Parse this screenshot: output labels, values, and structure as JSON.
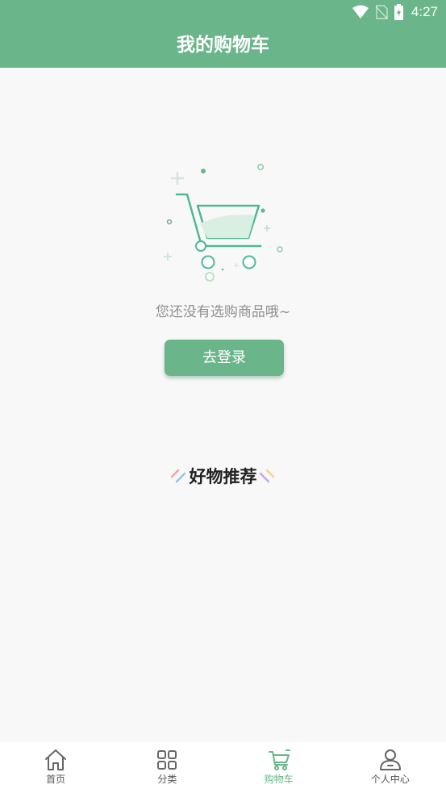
{
  "status_bar": {
    "time": "4:27"
  },
  "header": {
    "title": "我的购物车"
  },
  "empty_state": {
    "message": "您还没有选购商品哦~",
    "login_button": "去登录"
  },
  "recommend": {
    "title": "好物推荐"
  },
  "tabbar": {
    "items": [
      {
        "label": "首页",
        "icon": "home-icon"
      },
      {
        "label": "分类",
        "icon": "category-grid-icon"
      },
      {
        "label": "购物车",
        "icon": "cart-icon",
        "active": true
      },
      {
        "label": "个人中心",
        "icon": "profile-icon"
      }
    ]
  },
  "colors": {
    "primary": "#6bb58a",
    "background": "#f8f8f8",
    "tab_inactive": "#555555"
  }
}
